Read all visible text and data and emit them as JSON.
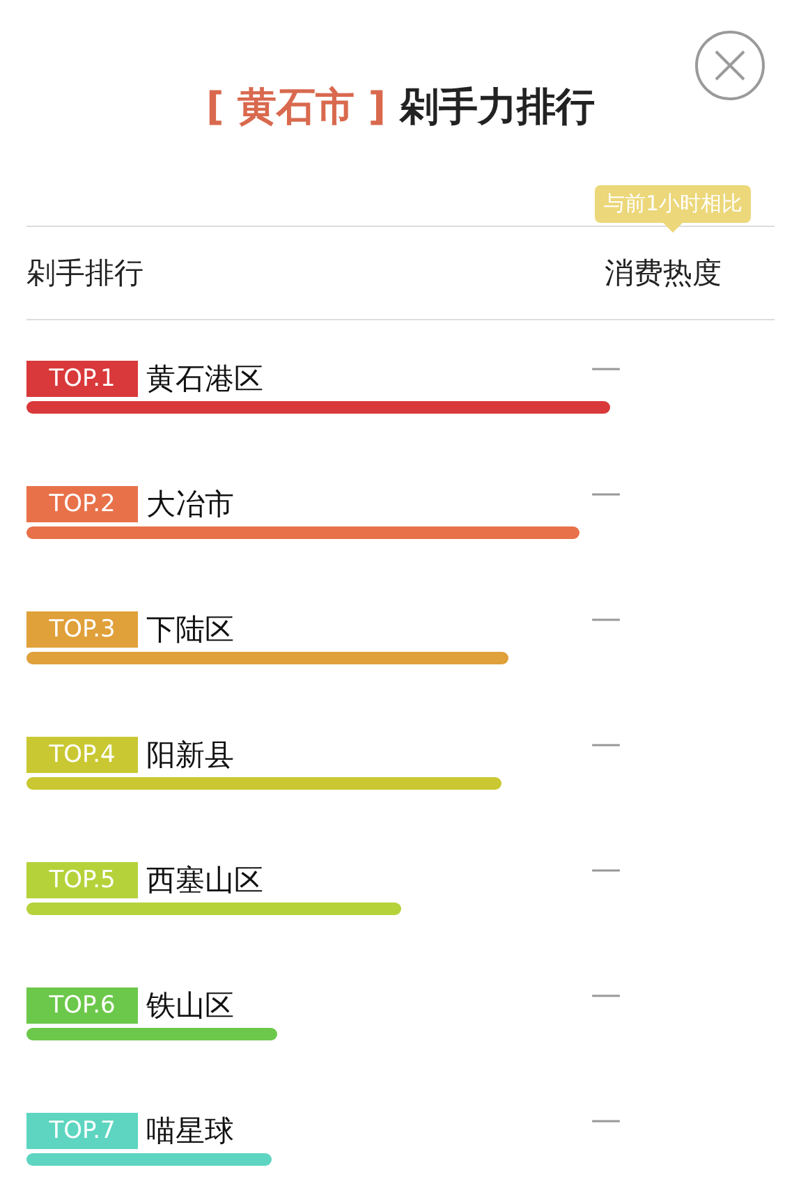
{
  "header": {
    "city": "[ 黄石市 ]",
    "title": "剁手力排行"
  },
  "tooltip": "与前1小时相比",
  "columns": [
    "剁手排行",
    "消费热度"
  ],
  "rows": [
    {
      "rank": "TOP.1",
      "name": "黄石港区",
      "trend": "—",
      "color": "#d9393a"
    },
    {
      "rank": "TOP.2",
      "name": "大冶市",
      "trend": "—",
      "color": "#e8714a"
    },
    {
      "rank": "TOP.3",
      "name": "下陆区",
      "trend": "—",
      "color": "#e0a03a"
    },
    {
      "rank": "TOP.4",
      "name": "阳新县",
      "trend": "—",
      "color": "#c9c832"
    },
    {
      "rank": "TOP.5",
      "name": "西塞山区",
      "trend": "—",
      "color": "#b5d23a"
    },
    {
      "rank": "TOP.6",
      "name": "铁山区",
      "trend": "—",
      "color": "#6cc84a"
    },
    {
      "rank": "TOP.7",
      "name": "喵星球",
      "trend": "—",
      "color": "#5dd5c0"
    }
  ]
}
